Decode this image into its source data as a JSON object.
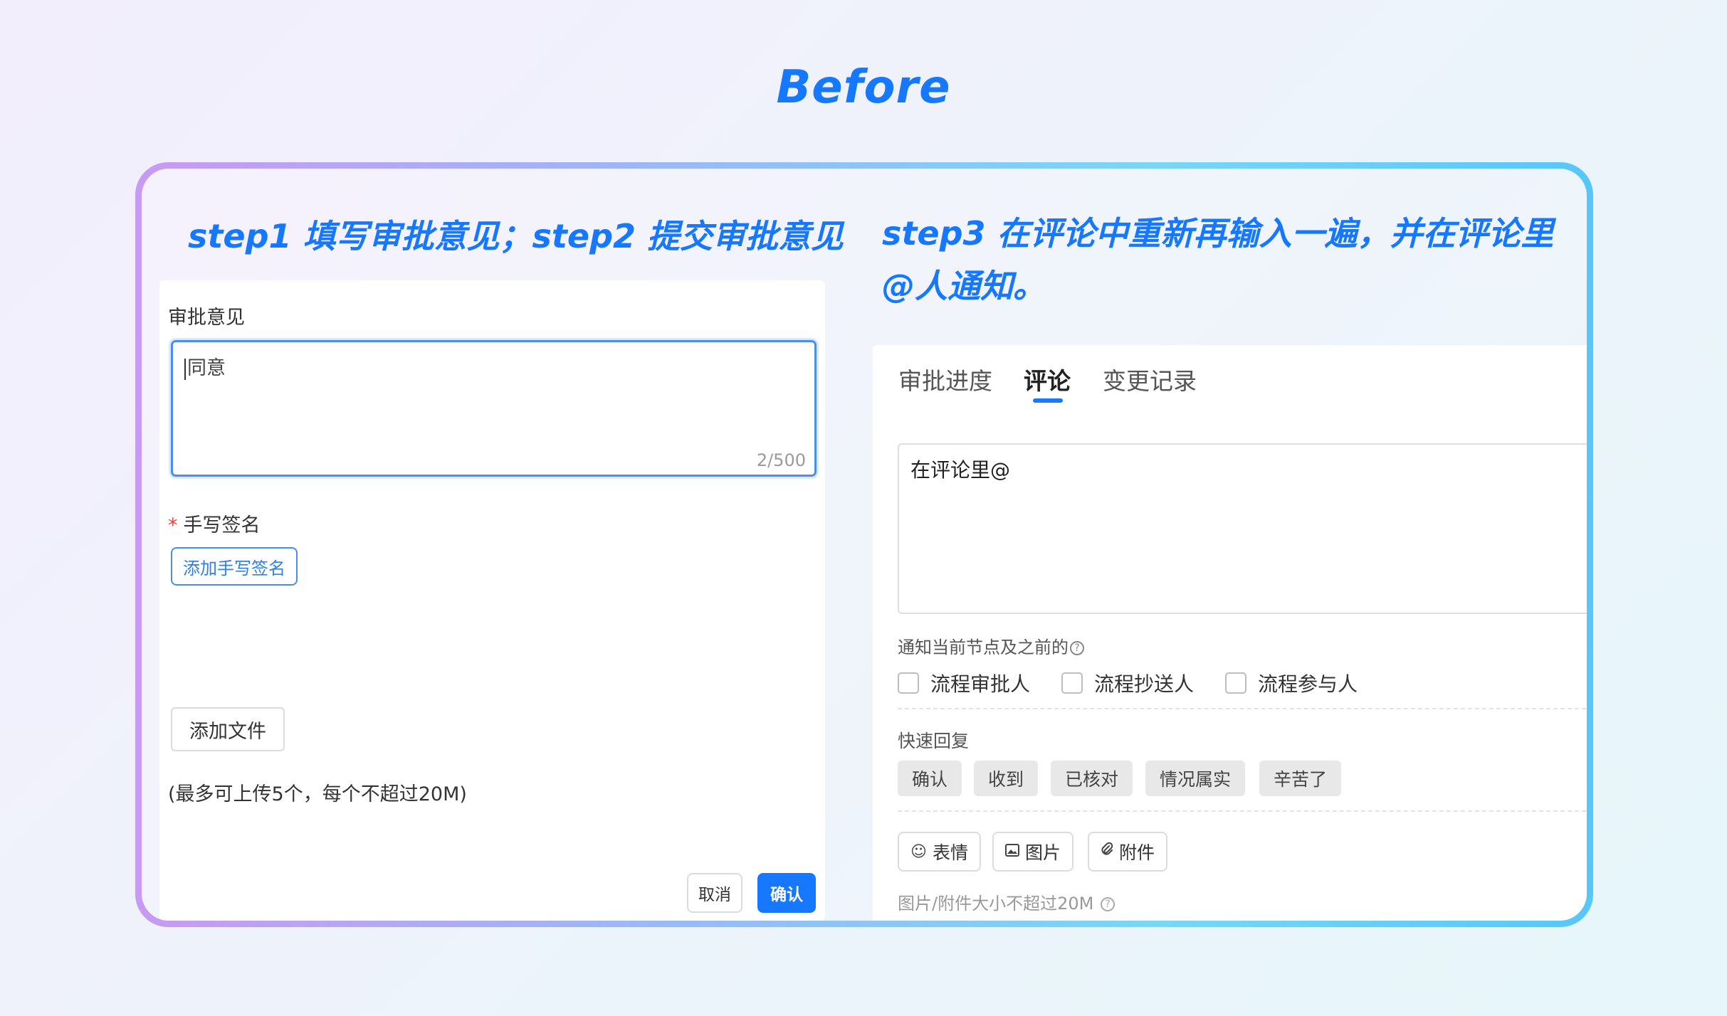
{
  "heading": "Before",
  "left_title": "step1 填写审批意见；step2 提交审批意见",
  "right_title": "step3 在评论中重新再输入一遍，并在评论里@人通知。",
  "approval": {
    "label": "审批意见",
    "value": "同意",
    "counter": "2/500",
    "signature_label": "手写签名",
    "required_mark": "*",
    "add_signature": "添加手写签名",
    "add_file": "添加文件",
    "upload_note": "(最多可上传5个，每个不超过20M)",
    "cancel": "取消",
    "confirm": "确认"
  },
  "comment_panel": {
    "tabs": [
      "审批进度",
      "评论",
      "变更记录"
    ],
    "active_tab": "评论",
    "input_value": "在评论里@",
    "notify_label": "通知当前节点及之前的",
    "help_glyph": "?",
    "checkboxes": [
      "流程审批人",
      "流程抄送人",
      "流程参与人"
    ],
    "quick_reply_label": "快速回复",
    "quick_replies": [
      "确认",
      "收到",
      "已核对",
      "情况属实",
      "辛苦了"
    ],
    "tools": [
      {
        "icon": "emoji-icon",
        "label": "表情"
      },
      {
        "icon": "image-icon",
        "label": "图片"
      },
      {
        "icon": "attachment-icon",
        "label": "附件"
      }
    ],
    "size_note": "图片/附件大小不超过20M"
  },
  "colors": {
    "accent": "#1677ff",
    "border_focus": "#4a8df2"
  }
}
